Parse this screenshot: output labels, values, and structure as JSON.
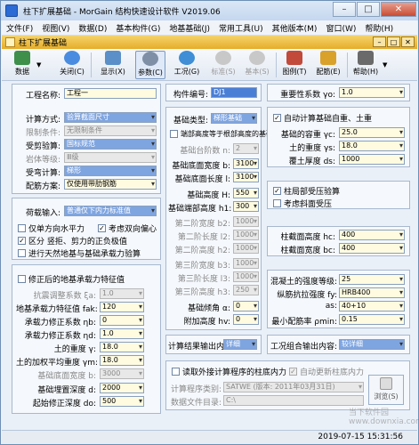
{
  "window": {
    "title": "柱下扩展基础 - MorGain 结构快速设计软件 V2019.06"
  },
  "menu": [
    "文件(F)",
    "视图(V)",
    "数据(D)",
    "基本构件(G)",
    "地基基础(J)",
    "常用工具(U)",
    "其他版本(M)",
    "窗口(W)",
    "帮助(H)"
  ],
  "child": {
    "title": "柱下扩展基础"
  },
  "toolbar": {
    "data": "数据",
    "close": "关闭(C)",
    "show": "显示(X)",
    "param": "参数(C)",
    "calc": "工况(G)",
    "std": "标准(S)",
    "basic": "基本(S)",
    "figure": "图例(T)",
    "assembly": "配筋(E)",
    "help": "帮助(H)"
  },
  "p1": {
    "label_name": "工程名称:",
    "name": "工程一",
    "label_calc": "计算方式:",
    "calc": "验算截面尺寸",
    "label_limit": "限制条件:",
    "limit": "无限制条件",
    "label_check": "受剪验算:",
    "check": "国标规范",
    "label_level": "岩体等级:",
    "level": "Ⅲ级",
    "label_stress": "受弯计算:",
    "stress": "梯形",
    "label_rebar": "配筋方案:",
    "rebar": "仅使用带肋钢筋"
  },
  "p2": {
    "label_load": "荷载输入:",
    "load": "普通仅下内力标准值",
    "cb_single": "仅单方向水平力",
    "cb_ecc": "考虑双向偏心",
    "cb_zone": "区分 竖拒、剪力的正负极值",
    "cb_natural": "进行天然地基与基础承载力验算"
  },
  "p3": {
    "cb_fix": "修正后的地基承载力特征值",
    "label_adj": "抗震调整系数 ξa:",
    "adj": "1.0",
    "label_fak": "地基承载力特征值 fak:",
    "fak": "120",
    "label_nb": "承载力修正系数 ηb:",
    "nb": "0",
    "label_nd": "承载力修正系数 ηd:",
    "nd": "1.0",
    "label_gamma": "土的重度 γ:",
    "gamma": "18.0",
    "label_gm": "土的加权平均重度 γm:",
    "gm": "18.0",
    "label_bw": "基础底面宽度 b:",
    "bw": "3000",
    "label_d": "基础埋置深度 d:",
    "d": "2000",
    "label_do": "起始修正深度 do:",
    "do": "500"
  },
  "p4": {
    "label_id": "构件编号:",
    "id": "DJ1"
  },
  "p5": {
    "label_type": "基础类型:",
    "type": "梯形基础",
    "cb_steps": "端部高度等于根部高度的基础",
    "label_n": "基础台阶数 n:",
    "n": "2",
    "label_b": "基础底面宽度 b:",
    "b": "3100",
    "label_l": "基础底面长度 l:",
    "l": "3100",
    "label_H": "基础高度 H:",
    "H": "550",
    "label_h1": "基础端部高度 h1:",
    "h1": "300",
    "label_b2": "第二阶宽度 b2:",
    "b2": "1000",
    "label_l2": "第二阶长度 l2:",
    "l2": "1000",
    "label_h2": "第二阶高度 h2:",
    "h2": "1000",
    "label_b3": "第三阶宽度 b3:",
    "b3": "1000",
    "label_l3": "第三阶长度 l3:",
    "l3": "1000",
    "label_h3": "第三阶高度 h3:",
    "h3": "250",
    "label_a": "基础倾角 α:",
    "a": "0",
    "label_hv": "附加高度 hv:",
    "hv": "0"
  },
  "p6": {
    "label_out": "计算结果输出内容:",
    "out": "详细"
  },
  "p7": {
    "label_gamma0": "重要性系数 γo:",
    "gamma0": "1.0"
  },
  "p8": {
    "cb_auto": "自动计算基础自重、土重",
    "label_gc": "基础的容重 γc:",
    "gc": "25.0",
    "label_gs": "土的重度 γs:",
    "gs": "18.0",
    "label_ds": "覆土厚度 ds:",
    "ds": "1000"
  },
  "p9": {
    "cb_pile": "柱局部受压验算",
    "cb_slope": "考虑斜面受压"
  },
  "p10": {
    "label_hc": "柱截面高度 hc:",
    "hc": "400",
    "label_bc": "柱截面宽度 bc:",
    "bc": "400"
  },
  "p11": {
    "label_fc": "混凝土的强度等级:",
    "fc": "25",
    "label_fy": "纵筋抗拉强度 fy:",
    "fy": "HRB400",
    "label_as": "as:",
    "as": "40+10",
    "label_pmin": "最小配筋率 ρmin:",
    "pmin": "0.15"
  },
  "p12": {
    "label_work": "工况组合输出内容:",
    "work": "较详细"
  },
  "p13": {
    "cb_read": "读取外接计算程序的柱底内力",
    "cb_refresh": "自动更新柱底内力",
    "label_prog": "计算程序类别:",
    "prog": "SATWE  (版本: 2011年03月31日)",
    "label_dir": "数据文件目录:",
    "dir": "C:\\",
    "browse": "浏览(S)"
  },
  "status": {
    "time": "2019-07-15 15:31:56"
  },
  "logo": {
    "text1": "当下软件园",
    "text2": "www.downxia.com"
  }
}
